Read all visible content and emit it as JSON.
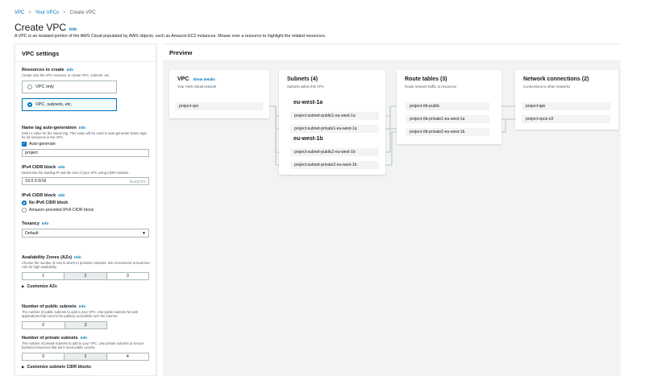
{
  "breadcrumb": {
    "item1": "VPC",
    "item2": "Your VPCs",
    "item3": "Create VPC"
  },
  "page": {
    "title": "Create VPC",
    "info": "Info",
    "description": "A VPC is an isolated portion of the AWS Cloud populated by AWS objects, such as Amazon EC2 instances. Mouse over a resource to highlight the related resources."
  },
  "settings": {
    "header": "VPC settings",
    "resources": {
      "label": "Resources to create",
      "info": "Info",
      "hint": "Create only the VPC resource or create VPC, subnets, etc.",
      "option_vpc_only": "VPC only",
      "option_vpc_more": "VPC, subnets, etc.",
      "selected": "VPC, subnets, etc."
    },
    "name_tag": {
      "label": "Name tag auto-generation",
      "info": "Info",
      "hint": "Enter a value for the Name tag. This value will be used to auto-generate Name tags for all resources in the VPC.",
      "checkbox_label": "Auto-generate",
      "value": "project"
    },
    "ipv4": {
      "label": "IPv4 CIDR block",
      "info": "Info",
      "hint": "Determine the starting IP and the size of your VPC using CIDR notation.",
      "value": "10.0.0.0/16",
      "suffix": "65,536 IPs"
    },
    "ipv6": {
      "label": "IPv6 CIDR block",
      "info": "Info",
      "option_none": "No IPv6 CIDR block",
      "option_amazon": "Amazon-provided IPv6 CIDR block"
    },
    "tenancy": {
      "label": "Tenancy",
      "info": "Info",
      "value": "Default"
    },
    "azs": {
      "label": "Availability Zones (AZs)",
      "info": "Info",
      "hint": "Choose the number of AZs in which to provision subnets. We recommend at least two AZs for high availability.",
      "options": [
        "1",
        "2",
        "3"
      ],
      "selected": "2",
      "customize": "Customize AZs"
    },
    "public_subnets": {
      "label": "Number of public subnets",
      "info": "Info",
      "hint": "The number of public subnets to add to your VPC. Use public subnets for web applications that need to be publicly accessible over the internet.",
      "options": [
        "0",
        "2"
      ],
      "selected": "2"
    },
    "private_subnets": {
      "label": "Number of private subnets",
      "info": "Info",
      "hint": "The number of private subnets to add to your VPC. Use private subnets to secure backend resources that don't need public access.",
      "options": [
        "0",
        "2",
        "4"
      ],
      "selected": "2"
    },
    "customize_cidr": "Customize subnets CIDR blocks"
  },
  "preview": {
    "header": "Preview",
    "vpc": {
      "title": "VPC",
      "link": "Show details",
      "subtitle": "Your AWS virtual network",
      "items": [
        "project-vpc"
      ]
    },
    "subnets": {
      "title": "Subnets (4)",
      "subtitle": "Subnets within this VPC",
      "az1": "eu-west-1a",
      "az1_items": [
        "project-subnet-public1-eu-west-1a",
        "project-subnet-private1-eu-west-1a"
      ],
      "az2": "eu-west-1b",
      "az2_items": [
        "project-subnet-public2-eu-west-1b",
        "project-subnet-private2-eu-west-1b"
      ]
    },
    "route_tables": {
      "title": "Route tables (3)",
      "subtitle": "Route network traffic to resources",
      "items": [
        "project-rtb-public",
        "project-rtb-private1-eu-west-1a",
        "project-rtb-private2-eu-west-1b"
      ]
    },
    "network": {
      "title": "Network connections (2)",
      "subtitle": "Connections to other networks",
      "items": [
        "project-igw",
        "project-vpce-s3"
      ]
    }
  }
}
